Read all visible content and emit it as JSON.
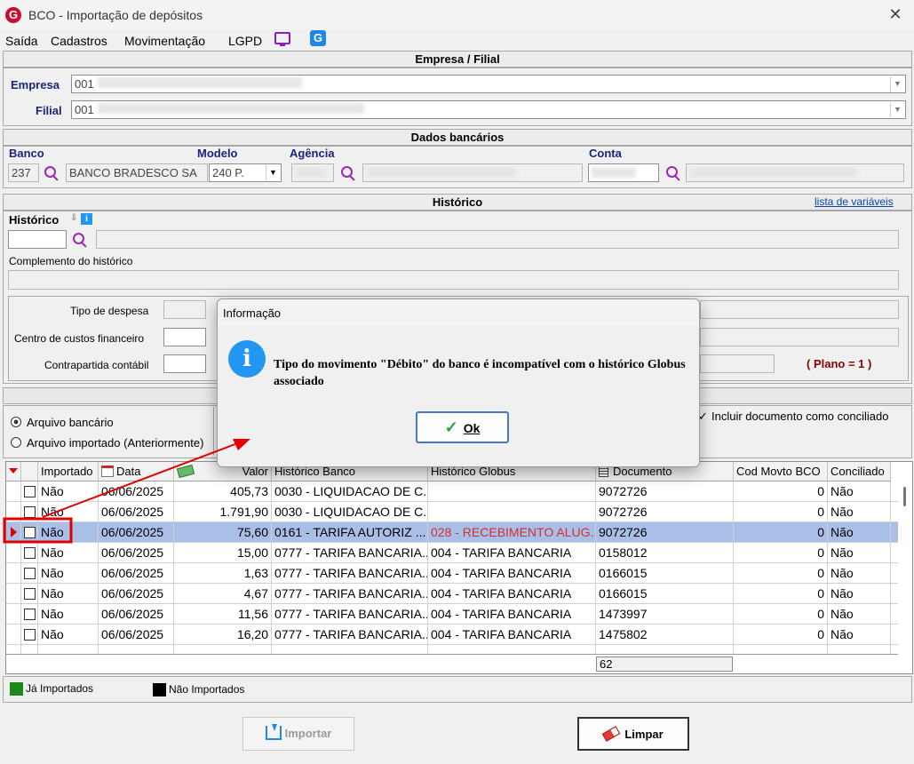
{
  "window": {
    "title": "BCO - Importação de depósitos",
    "close_glyph": "✕",
    "app_icon": "G"
  },
  "menu": {
    "items": [
      "Saída",
      "Cadastros",
      "Movimentação",
      "LGPD"
    ],
    "extra_icon": "G"
  },
  "empresa_section": {
    "header": "Empresa / Filial",
    "empresa_label": "Empresa",
    "empresa_value": "001",
    "filial_label": "Filial",
    "filial_value": "001"
  },
  "dados": {
    "header": "Dados bancários",
    "banco_label": "Banco",
    "banco_code": "237",
    "banco_name": "BANCO BRADESCO SA",
    "modelo_label": "Modelo",
    "modelo_value": "240 P.",
    "agencia_label": "Agência",
    "conta_label": "Conta"
  },
  "historico": {
    "header": "Histórico",
    "link": "lista de variáveis",
    "historico_label": "Histórico",
    "info_glyph": "i",
    "complemento_label": "Complemento do histórico",
    "tipo_despesa_label": "Tipo de despesa",
    "centro_custos_label": "Centro de custos financeiro",
    "contrapartida_label": "Contrapartida contábil",
    "plano_text": "( Plano = 1 )"
  },
  "import": {
    "arquivo_bancario": "Arquivo bancário",
    "arquivo_importado": "Arquivo importado (Anteriormente)",
    "incluir_label": "Incluir documento como conciliado"
  },
  "grid": {
    "headers": [
      "Importado",
      "Data",
      "Valor",
      "Histórico Banco",
      "Histórico Globus",
      "Documento",
      "Cod Movto BCO",
      "Conciliado"
    ],
    "rows": [
      {
        "importado": "Não",
        "data": "06/06/2025",
        "valor": "405,73",
        "hist_banco": "0030 - LIQUIDACAO DE C...",
        "hist_globus": "",
        "documento": "9072726",
        "cod": "0",
        "conciliado": "Não"
      },
      {
        "importado": "Não",
        "data": "06/06/2025",
        "valor": "1.791,90",
        "hist_banco": "0030 - LIQUIDACAO DE C...",
        "hist_globus": "",
        "documento": "9072726",
        "cod": "0",
        "conciliado": "Não"
      },
      {
        "importado": "Não",
        "data": "06/06/2025",
        "valor": "75,60",
        "hist_banco": "0161 - TARIFA AUTORIZ ...",
        "hist_globus": "028 - RECEBIMENTO ALUG...",
        "documento": "9072726",
        "cod": "0",
        "conciliado": "Não"
      },
      {
        "importado": "Não",
        "data": "06/06/2025",
        "valor": "15,00",
        "hist_banco": "0777 - TARIFA BANCARIA...",
        "hist_globus": "004 - TARIFA BANCARIA",
        "documento": "0158012",
        "cod": "0",
        "conciliado": "Não"
      },
      {
        "importado": "Não",
        "data": "06/06/2025",
        "valor": "1,63",
        "hist_banco": "0777 - TARIFA BANCARIA...",
        "hist_globus": "004 - TARIFA BANCARIA",
        "documento": "0166015",
        "cod": "0",
        "conciliado": "Não"
      },
      {
        "importado": "Não",
        "data": "06/06/2025",
        "valor": "4,67",
        "hist_banco": "0777 - TARIFA BANCARIA...",
        "hist_globus": "004 - TARIFA BANCARIA",
        "documento": "0166015",
        "cod": "0",
        "conciliado": "Não"
      },
      {
        "importado": "Não",
        "data": "06/06/2025",
        "valor": "11,56",
        "hist_banco": "0777 - TARIFA BANCARIA...",
        "hist_globus": "004 - TARIFA BANCARIA",
        "documento": "1473997",
        "cod": "0",
        "conciliado": "Não"
      },
      {
        "importado": "Não",
        "data": "06/06/2025",
        "valor": "16,20",
        "hist_banco": "0777 - TARIFA BANCARIA...",
        "hist_globus": "004 - TARIFA BANCARIA",
        "documento": "1475802",
        "cod": "0",
        "conciliado": "Não"
      }
    ],
    "total": "62"
  },
  "legend": {
    "ja": "Já Importados",
    "nao": "Não Importados",
    "ja_color": "#1b8a1b",
    "nao_color": "#000000"
  },
  "buttons": {
    "importar": "Importar",
    "limpar": "Limpar"
  },
  "dialog": {
    "title": "Informação",
    "info_glyph": "i",
    "message": "Tipo do movimento \"Débito\" do banco é incompatível com o histórico Globus associado",
    "ok": "Ok"
  }
}
